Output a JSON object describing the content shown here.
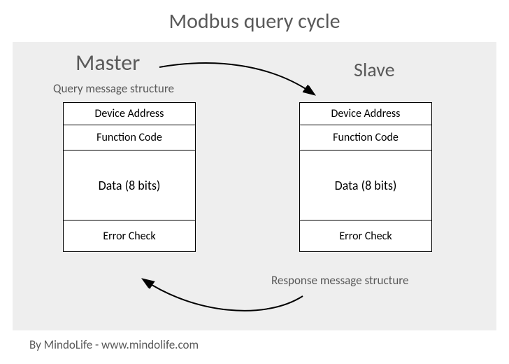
{
  "title": "Modbus query cycle",
  "roles": {
    "master": "Master",
    "slave": "Slave"
  },
  "captions": {
    "query": "Query message structure",
    "response": "Response message structure"
  },
  "master_msg": {
    "address": "Device Address",
    "function": "Function Code",
    "data": "Data (8 bits)",
    "error": "Error Check"
  },
  "slave_msg": {
    "address": "Device Address",
    "function": "Function Code",
    "data": "Data (8 bits)",
    "error": "Error Check"
  },
  "credit": "By MindoLife - www.mindolife.com"
}
